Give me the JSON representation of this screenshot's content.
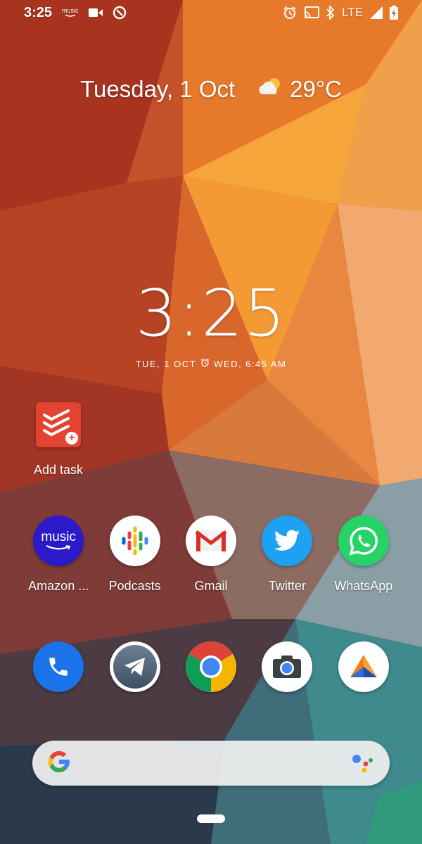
{
  "status_bar": {
    "time": "3:25",
    "notification_icons": [
      "amazon-music-icon",
      "video-camera-icon",
      "app-notification-icon"
    ],
    "music_text": "music",
    "network_label": "LTE",
    "right_icons": [
      "alarm-icon",
      "cast-icon",
      "bluetooth-icon",
      "signal-icon",
      "battery-charging-icon"
    ]
  },
  "at_a_glance": {
    "date": "Tuesday, 1 Oct",
    "weather_icon": "partly-cloudy-icon",
    "temperature": "29°C"
  },
  "clock": {
    "time": "3:25",
    "date": "TUE, 1 OCT",
    "alarm": "WED, 6:45 AM"
  },
  "widget": {
    "label": "Add task",
    "icon": "todoist-add-task-icon",
    "color": "#e44332"
  },
  "apps": [
    {
      "label": "Amazon ...",
      "icon": "amazon-music-icon",
      "icon_text": "music"
    },
    {
      "label": "Podcasts",
      "icon": "google-podcasts-icon"
    },
    {
      "label": "Gmail",
      "icon": "gmail-icon"
    },
    {
      "label": "Twitter",
      "icon": "twitter-icon"
    },
    {
      "label": "WhatsApp",
      "icon": "whatsapp-icon"
    }
  ],
  "dock": [
    {
      "icon": "phone-icon"
    },
    {
      "icon": "telegram-icon"
    },
    {
      "icon": "chrome-icon"
    },
    {
      "icon": "camera-icon"
    },
    {
      "icon": "transmute-app-icon"
    }
  ],
  "search": {
    "logo": "google-g-icon",
    "assistant": "google-assistant-icon"
  },
  "colors": {
    "amazon_music": "#2a1ac9",
    "twitter": "#1da1f2",
    "whatsapp": "#25d366",
    "phone": "#1a73e8"
  }
}
